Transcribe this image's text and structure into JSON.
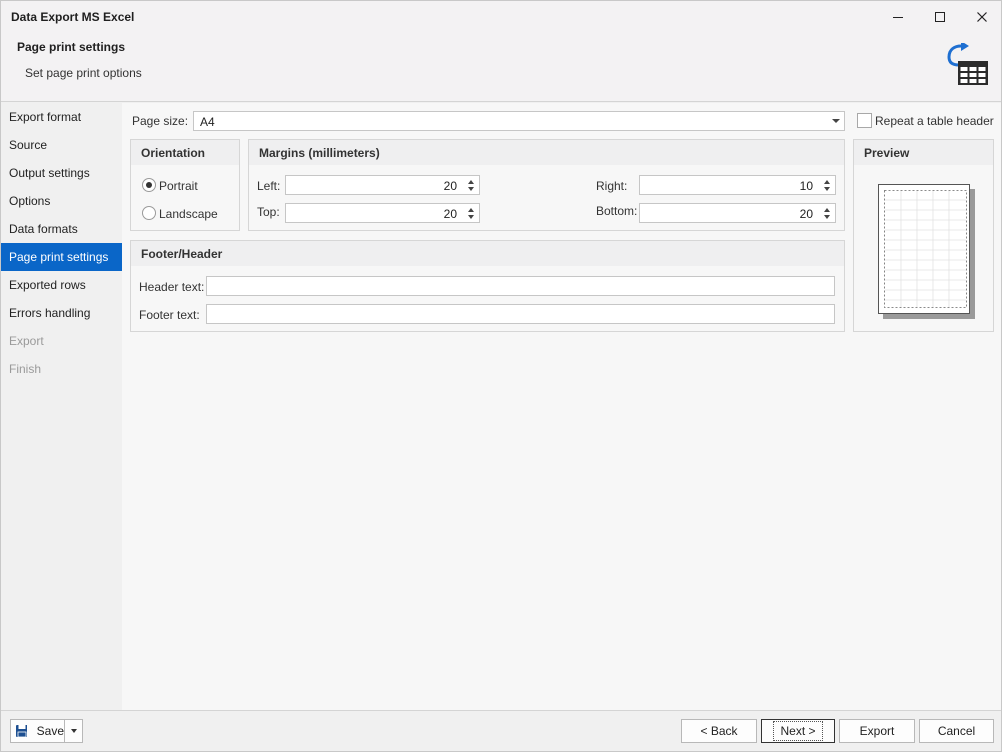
{
  "window": {
    "title": "Data Export MS Excel"
  },
  "header": {
    "title": "Page print settings",
    "subtitle": "Set page print options",
    "icon": "export-table-icon",
    "icon_color": "#1e6fd1"
  },
  "sidebar": {
    "items": [
      {
        "label": "Export format",
        "state": "normal"
      },
      {
        "label": "Source",
        "state": "normal"
      },
      {
        "label": "Output settings",
        "state": "normal"
      },
      {
        "label": "Options",
        "state": "normal"
      },
      {
        "label": "Data formats",
        "state": "normal"
      },
      {
        "label": "Page print settings",
        "state": "active"
      },
      {
        "label": "Exported rows",
        "state": "normal"
      },
      {
        "label": "Errors handling",
        "state": "normal"
      },
      {
        "label": "Export",
        "state": "disabled"
      },
      {
        "label": "Finish",
        "state": "disabled"
      }
    ],
    "active_color": "#0a66c8"
  },
  "page_size": {
    "label": "Page size:",
    "value": "A4"
  },
  "repeat_header": {
    "label": "Repeat a table header",
    "checked": false
  },
  "orientation": {
    "title": "Orientation",
    "portrait_label": "Portrait",
    "landscape_label": "Landscape",
    "selected": "Portrait"
  },
  "margins": {
    "title": "Margins (millimeters)",
    "left_label": "Left:",
    "left_value": "20",
    "top_label": "Top:",
    "top_value": "20",
    "right_label": "Right:",
    "right_value": "10",
    "bottom_label": "Bottom:",
    "bottom_value": "20"
  },
  "preview": {
    "title": "Preview"
  },
  "footer_header": {
    "title": "Footer/Header",
    "header_label": "Header text:",
    "header_value": "",
    "footer_label": "Footer text:",
    "footer_value": ""
  },
  "buttons": {
    "save": "Save",
    "back": "< Back",
    "next": "Next >",
    "export": "Export",
    "cancel": "Cancel"
  }
}
